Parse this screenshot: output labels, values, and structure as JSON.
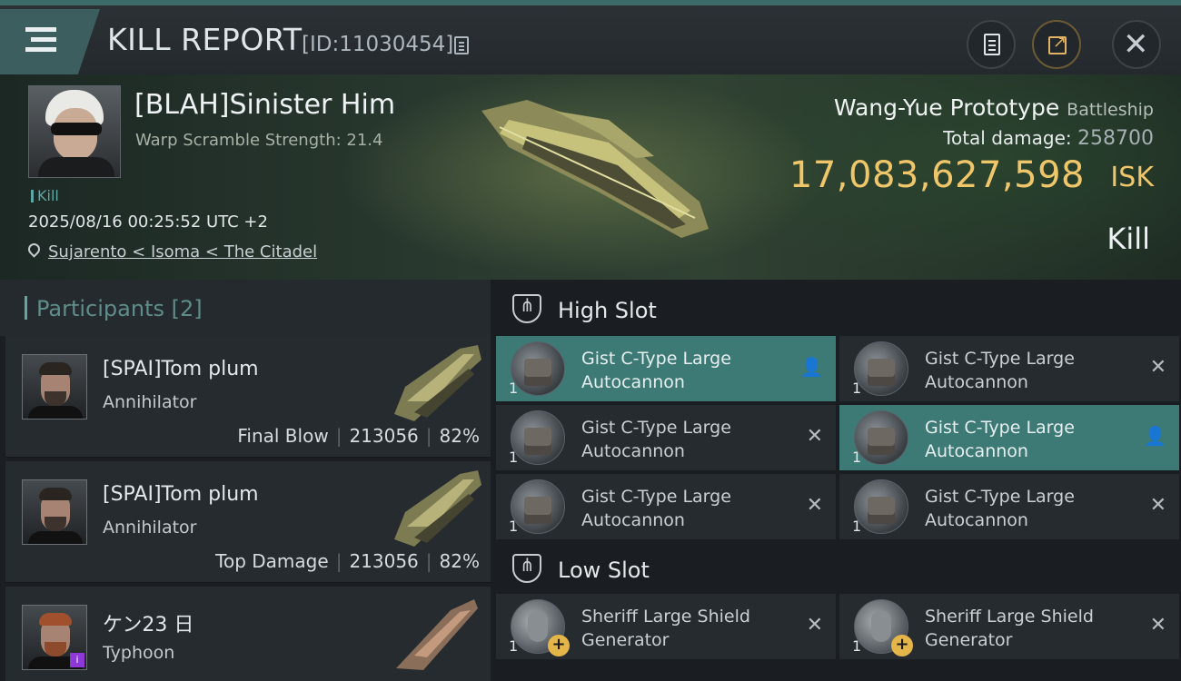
{
  "header": {
    "title": "KILL REPORT",
    "report_id": "[ID:11030454]"
  },
  "victim": {
    "name": "[BLAH]Sinister Him",
    "warp_scramble": "Warp Scramble Strength: 21.4",
    "tag": "Kill",
    "datetime": "2025/08/16 00:25:52 UTC +2",
    "location": "Sujarento < Isoma < The Citadel",
    "ship_name": "Wang-Yue Prototype",
    "ship_class": "Battleship",
    "total_damage_label": "Total damage:",
    "total_damage": "258700",
    "isk_value": "17,083,627,598",
    "isk_unit": "ISK",
    "result": "Kill"
  },
  "participants": {
    "title": "Participants [2]",
    "rows": [
      {
        "name": "[SPAI]Tom plum",
        "ship": "Annihilator",
        "role": "Final Blow",
        "damage": "213056",
        "percent": "82%"
      },
      {
        "name": "[SPAI]Tom plum",
        "ship": "Annihilator",
        "role": "Top Damage",
        "damage": "213056",
        "percent": "82%"
      },
      {
        "name": "ケン23 日",
        "ship": "Typhoon"
      }
    ]
  },
  "fitting": {
    "high_slot_title": "High Slot",
    "low_slot_title": "Low Slot",
    "high_slot": [
      {
        "name": "Gist C-Type Large Autocannon",
        "qty": "1",
        "status": "dropped"
      },
      {
        "name": "Gist C-Type Large Autocannon",
        "qty": "1",
        "status": "destroyed"
      },
      {
        "name": "Gist C-Type Large Autocannon",
        "qty": "1",
        "status": "destroyed"
      },
      {
        "name": "Gist C-Type Large Autocannon",
        "qty": "1",
        "status": "dropped"
      },
      {
        "name": "Gist C-Type Large Autocannon",
        "qty": "1",
        "status": "destroyed"
      },
      {
        "name": "Gist C-Type Large Autocannon",
        "qty": "1",
        "status": "destroyed"
      }
    ],
    "low_slot": [
      {
        "name": "Sheriff Large Shield Generator",
        "qty": "1",
        "status": "destroyed"
      },
      {
        "name": "Sheriff Large Shield Generator",
        "qty": "1",
        "status": "destroyed"
      }
    ]
  },
  "icons": {
    "state_dropped": "👤",
    "state_destroyed": "✕",
    "close": "✕"
  },
  "colors": {
    "accent": "#3d7a76",
    "isk": "#f0c66a",
    "header": "#2c3136"
  }
}
